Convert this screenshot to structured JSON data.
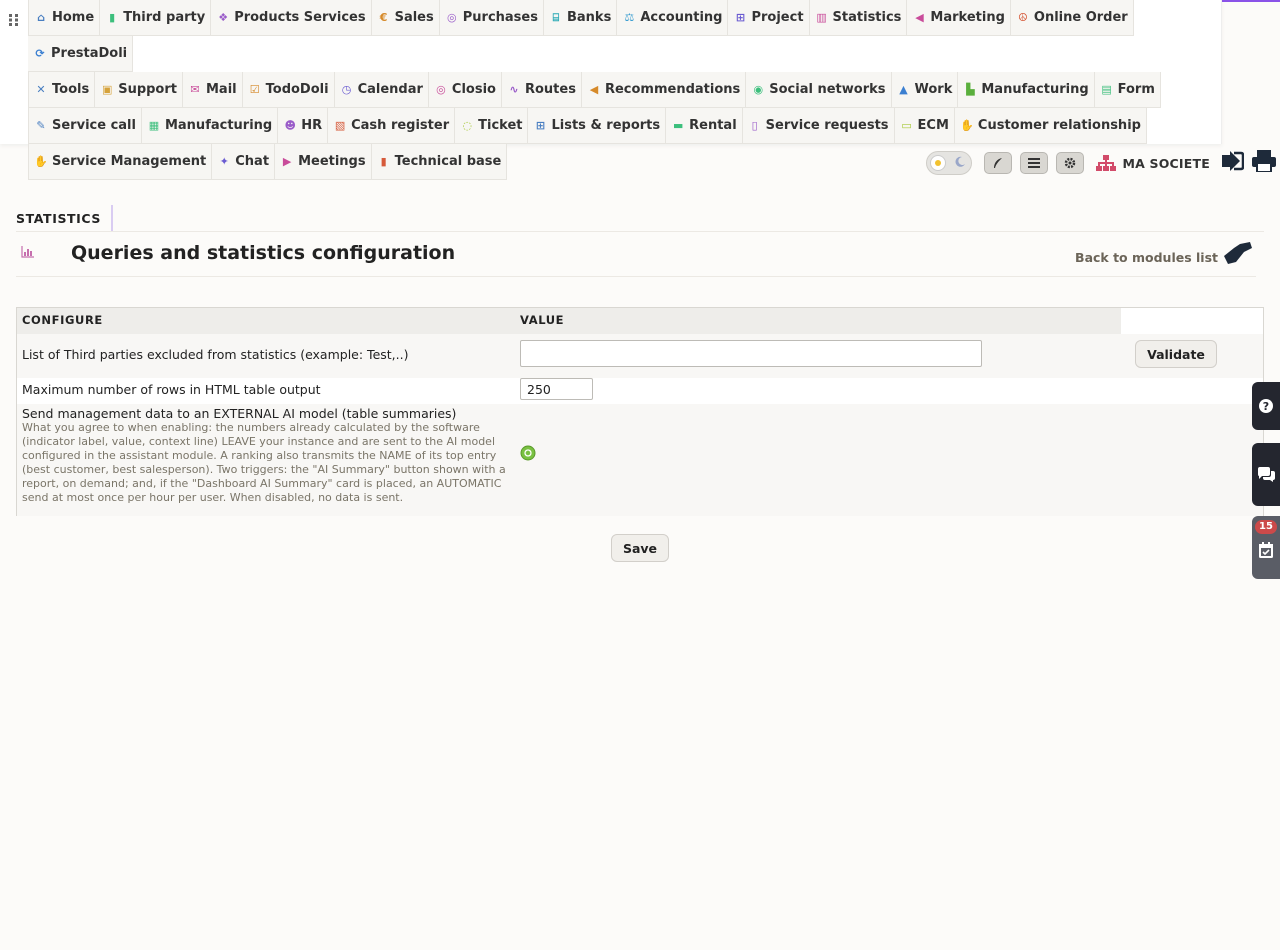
{
  "colors": {
    "accent": "#8a52e8",
    "menu_bg": "#f7f6f3",
    "dark_tab": "#24262f",
    "badge": "#cc4a4a",
    "status_on": "#7ac142"
  },
  "menu": [
    {
      "label": "Home",
      "icon": "home-icon",
      "color": "#4a7fc1"
    },
    {
      "label": "Third party",
      "icon": "building-icon",
      "color": "#3cbf7c"
    },
    {
      "label": "Products Services",
      "icon": "cubes-icon",
      "color": "#9a5cc9"
    },
    {
      "label": "Sales",
      "icon": "euro-icon",
      "color": "#d68a2a"
    },
    {
      "label": "Purchases",
      "icon": "coins-icon",
      "color": "#9a5cc9"
    },
    {
      "label": "Banks",
      "icon": "bank-icon",
      "color": "#2aa9b5"
    },
    {
      "label": "Accounting",
      "icon": "scale-icon",
      "color": "#3b9ed1"
    },
    {
      "label": "Project",
      "icon": "sitemap-icon",
      "color": "#6a5bd1"
    },
    {
      "label": "Statistics",
      "icon": "chart-bar-icon",
      "color": "#c94c9a"
    },
    {
      "label": "Marketing",
      "icon": "megaphone-icon",
      "color": "#c94c9a"
    },
    {
      "label": "Online Order",
      "icon": "peace-icon",
      "color": "#d65a3a"
    },
    {
      "label": "PrestaDoli",
      "icon": "sync-icon",
      "color": "#3b7fd1"
    },
    {
      "label": "Tools",
      "icon": "tools-icon",
      "color": "#4a7fc1"
    },
    {
      "label": "Support",
      "icon": "briefcase-icon",
      "color": "#d6a23a"
    },
    {
      "label": "Mail",
      "icon": "mail-bulk-icon",
      "color": "#c94c9a"
    },
    {
      "label": "TodoDoli",
      "icon": "calendar-check-icon",
      "color": "#d68a2a"
    },
    {
      "label": "Calendar",
      "icon": "clock-icon",
      "color": "#6a5bd1"
    },
    {
      "label": "Closio",
      "icon": "target-icon",
      "color": "#c94c9a"
    },
    {
      "label": "Routes",
      "icon": "route-icon",
      "color": "#9a5cc9"
    },
    {
      "label": "Recommendations",
      "icon": "bullhorn-icon",
      "color": "#d68a2a"
    },
    {
      "label": "Social networks",
      "icon": "broadcast-icon",
      "color": "#3cbf7c"
    },
    {
      "label": "Work",
      "icon": "road-icon",
      "color": "#3b7fd1"
    },
    {
      "label": "Manufacturing",
      "icon": "industry-icon",
      "color": "#5aaf3c"
    },
    {
      "label": "Form",
      "icon": "form-icon",
      "color": "#3cbf7c"
    },
    {
      "label": "Service call",
      "icon": "wrench-icon",
      "color": "#4a7fc1"
    },
    {
      "label": "Manufacturing",
      "icon": "microchip-icon",
      "color": "#3cbf7c"
    },
    {
      "label": "HR",
      "icon": "users-icon",
      "color": "#9a5cc9"
    },
    {
      "label": "Cash register",
      "icon": "cash-register-icon",
      "color": "#d65a3a"
    },
    {
      "label": "Ticket",
      "icon": "headset-icon",
      "color": "#a8c93a"
    },
    {
      "label": "Lists & reports",
      "icon": "table-icon",
      "color": "#4a7fc1"
    },
    {
      "label": "Rental",
      "icon": "truck-icon",
      "color": "#3cbf7c"
    },
    {
      "label": "Service requests",
      "icon": "file-medical-icon",
      "color": "#9a5cc9"
    },
    {
      "label": "ECM",
      "icon": "folder-open-icon",
      "color": "#a8c93a"
    },
    {
      "label": "Customer relationship",
      "icon": "handshake-icon",
      "color": "#c94c9a"
    },
    {
      "label": "Service Management",
      "icon": "hands-helping-icon",
      "color": "#3cbf7c"
    },
    {
      "label": "Chat",
      "icon": "comments-icon",
      "color": "#6a5bd1"
    },
    {
      "label": "Meetings",
      "icon": "video-icon",
      "color": "#c94c9a"
    },
    {
      "label": "Technical base",
      "icon": "book-icon",
      "color": "#d65a3a"
    }
  ],
  "toolbar": {
    "company": "MA SOCIETE"
  },
  "breadcrumb": "STATISTICS",
  "page": {
    "title": "Queries and statistics configuration",
    "back_link": "Back to modules list"
  },
  "table": {
    "col_config": "CONFIGURE",
    "col_value": "VALUE",
    "rows": [
      {
        "label": "List of Third parties excluded from statistics (example: Test,..)",
        "value": "",
        "button": "Validate"
      },
      {
        "label": "Maximum number of rows in HTML table output",
        "value": "250"
      },
      {
        "label": "Send management data to an EXTERNAL AI model (table summaries)",
        "description": "What you agree to when enabling: the numbers already calculated by the software (indicator label, value, context line) LEAVE your instance and are sent to the AI model configured in the assistant module. A ranking also transmits the NAME of its top entry (best customer, best salesperson). Two triggers: the \"AI Summary\" button shown with a report, on demand; and, if the \"Dashboard AI Summary\" card is placed, an AUTOMATIC send at most once per hour per user. When disabled, no data is sent."
      }
    ]
  },
  "save_button": "Save",
  "side": {
    "badge_count": "15"
  }
}
